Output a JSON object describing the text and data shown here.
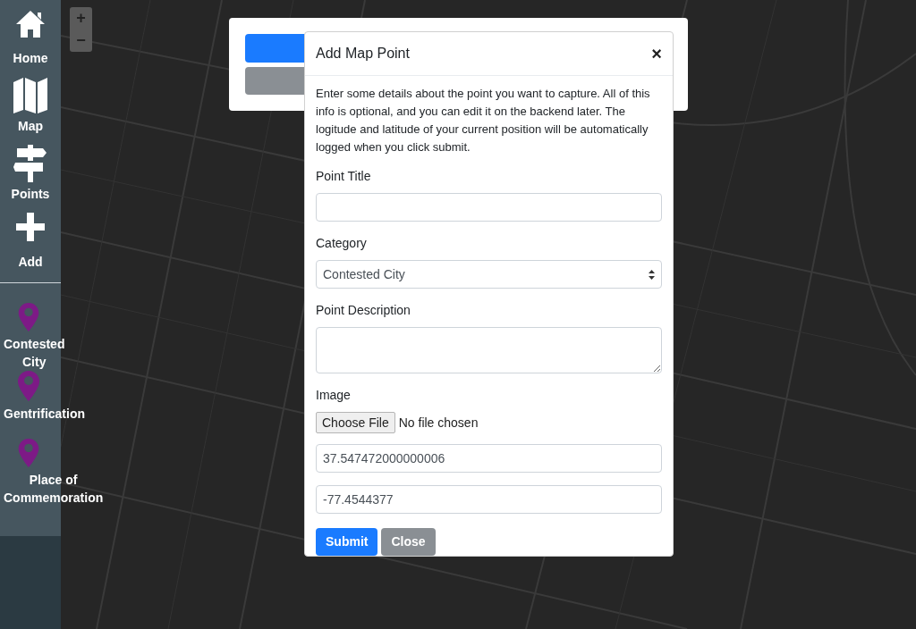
{
  "sidebar": {
    "nav": [
      {
        "label": "Home"
      },
      {
        "label": "Map"
      },
      {
        "label": "Points"
      },
      {
        "label": "Add"
      }
    ],
    "categories": [
      {
        "label": "Contested City"
      },
      {
        "label": "Gentrification"
      },
      {
        "label": "Place of Commemoration"
      }
    ]
  },
  "map_controls": {
    "zoom_in": "+",
    "zoom_out": "−"
  },
  "modal": {
    "title": "Add Map Point",
    "close": "×",
    "intro": "Enter some details about the point you want to capture. All of this info is optional, and you can edit it on the backend later. The logitude and latitude of your current position will be automatically logged when you click submit.",
    "fields": [
      {
        "kind": "text",
        "label": "Point Title"
      },
      {
        "kind": "select",
        "label": "Category",
        "value": "Contested City"
      },
      {
        "kind": "textarea",
        "label": "Point Description"
      },
      {
        "kind": "file",
        "label": "Image",
        "button": "Choose File",
        "status": "No file chosen"
      },
      {
        "kind": "text",
        "value": "37.547472000000006"
      },
      {
        "kind": "text",
        "value": "-77.4544377"
      }
    ],
    "buttons": [
      {
        "kind": "primary",
        "label": "Submit"
      },
      {
        "kind": "secondary",
        "label": "Close"
      }
    ]
  }
}
